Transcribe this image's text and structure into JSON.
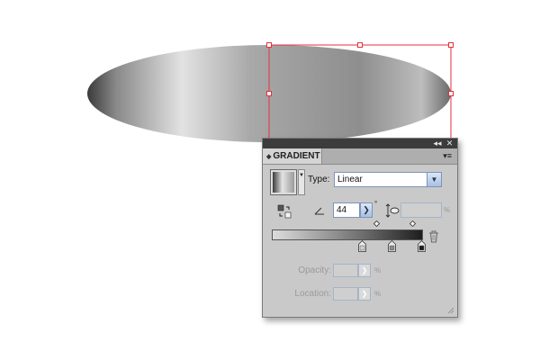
{
  "panel": {
    "title": "GRADIENT",
    "collapse_glyph": "◂◂",
    "close_glyph": "✕",
    "menu_glyph": "▾≡",
    "tab_arrow_glyph": "◆"
  },
  "gradient": {
    "type_label": "Type:",
    "type_value": "Linear",
    "angle_value": "44",
    "degree_symbol": "°",
    "aspect_suffix": "%",
    "opacity_label": "Opacity:",
    "opacity_suffix": "%",
    "location_label": "Location:",
    "location_suffix": "%",
    "dropdown_glyph": "▼",
    "stepper_glyph": "❯"
  },
  "colors": {
    "selection": "#e0323c",
    "panel_bg": "#c9c9c9",
    "panel_topbar": "#3c3c3c",
    "field_border": "#7d93b8"
  },
  "icons": {
    "reverse": "reverse-gradient-icon",
    "angle": "angle-icon",
    "aspect": "aspect-ratio-icon",
    "delete": "trash-icon"
  }
}
